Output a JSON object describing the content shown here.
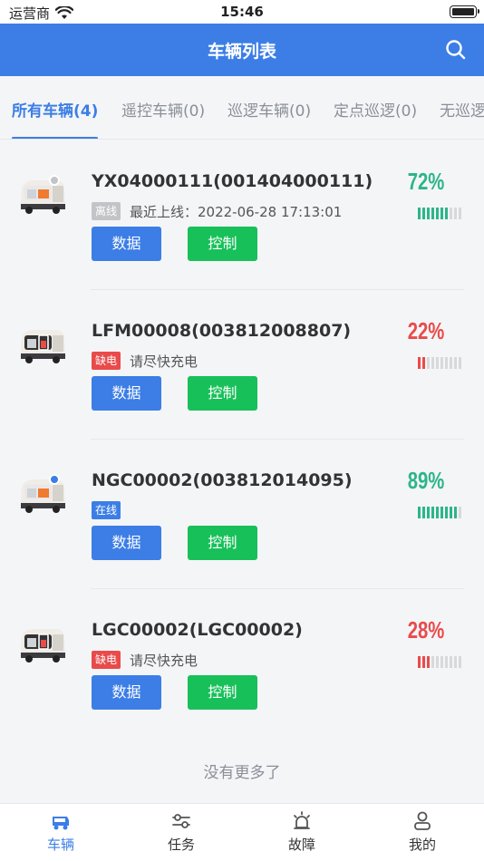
{
  "status_bar": {
    "carrier": "运营商",
    "time": "15:46"
  },
  "nav": {
    "title": "车辆列表",
    "search_icon": "search-icon"
  },
  "tabs": [
    {
      "label": "所有车辆(4)",
      "active": true
    },
    {
      "label": "遥控车辆(0)",
      "active": false
    },
    {
      "label": "巡逻车辆(0)",
      "active": false
    },
    {
      "label": "定点巡逻(0)",
      "active": false
    },
    {
      "label": "无巡逻",
      "active": false
    }
  ],
  "vehicles": [
    {
      "name": "YX04000111(001404000111)",
      "tag": "离线",
      "tag_type": "offline",
      "status_text": "最近上线：2022-06-28 17:13:01",
      "battery": "72%",
      "battery_level": 72,
      "battery_color": "#2cb58a",
      "online_dot": "#c2c4c8"
    },
    {
      "name": "LFM00008(003812008807)",
      "tag": "缺电",
      "tag_type": "lowbatt",
      "status_text": "请尽快充电",
      "battery": "22%",
      "battery_level": 22,
      "battery_color": "#e94b4b",
      "online_dot": null
    },
    {
      "name": "NGC00002(003812014095)",
      "tag": "在线",
      "tag_type": "online",
      "status_text": "",
      "battery": "89%",
      "battery_level": 89,
      "battery_color": "#2cb58a",
      "online_dot": "#3c7ee6"
    },
    {
      "name": "LGC00002(LGC00002)",
      "tag": "缺电",
      "tag_type": "lowbatt",
      "status_text": "请尽快充电",
      "battery": "28%",
      "battery_level": 28,
      "battery_color": "#e94b4b",
      "online_dot": null
    }
  ],
  "buttons": {
    "data_label": "数据",
    "control_label": "控制"
  },
  "footer": {
    "no_more": "没有更多了"
  },
  "tabbar": [
    {
      "label": "车辆",
      "icon": "vehicle-icon",
      "active": true
    },
    {
      "label": "任务",
      "icon": "task-icon",
      "active": false
    },
    {
      "label": "故障",
      "icon": "alarm-icon",
      "active": false
    },
    {
      "label": "我的",
      "icon": "profile-icon",
      "active": false
    }
  ],
  "colors": {
    "primary": "#3c7ee6",
    "success": "#18c05a",
    "danger": "#e94b4b",
    "teal": "#2cb58a"
  }
}
